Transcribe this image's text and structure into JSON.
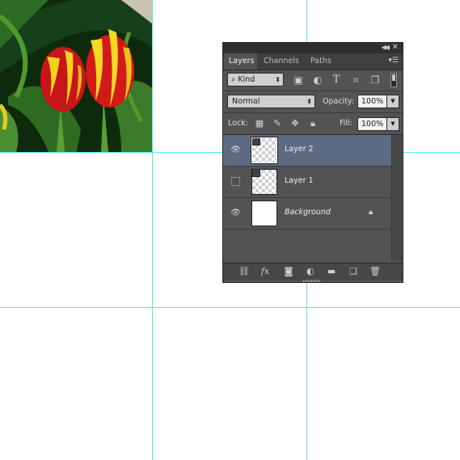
{
  "canvas": {
    "photo_alt": "tulips"
  },
  "panel": {
    "tabs": [
      {
        "label": "Layers",
        "active": true
      },
      {
        "label": "Channels",
        "active": false
      },
      {
        "label": "Paths",
        "active": false
      }
    ],
    "filter": {
      "kind_label": "Kind",
      "icons": [
        "image-filter-icon",
        "adjustment-filter-icon",
        "type-filter-icon",
        "shape-filter-icon",
        "smart-object-filter-icon"
      ]
    },
    "blend_mode": "Normal",
    "opacity_label": "Opacity:",
    "opacity_value": "100%",
    "lock_label": "Lock:",
    "lock_icons": [
      "lock-transparent-icon",
      "lock-image-icon",
      "lock-position-icon",
      "lock-all-icon"
    ],
    "fill_label": "Fill:",
    "fill_value": "100%",
    "layers": [
      {
        "name": "Layer 2",
        "visible": true,
        "selected": true
      },
      {
        "name": "Layer 1",
        "visible": false,
        "selected": false
      },
      {
        "name": "Background",
        "visible": true,
        "selected": false,
        "locked": true
      }
    ],
    "bottom_icons": [
      "link-layers-icon",
      "fx-icon",
      "layer-mask-icon",
      "adjustment-layer-icon",
      "new-group-icon",
      "new-layer-icon",
      "delete-icon"
    ],
    "bottom_fx_label": "fx"
  },
  "colors": {
    "guide": "#5fe0ee",
    "panel_bg": "#535353",
    "selected_layer": "#5d6b82"
  }
}
